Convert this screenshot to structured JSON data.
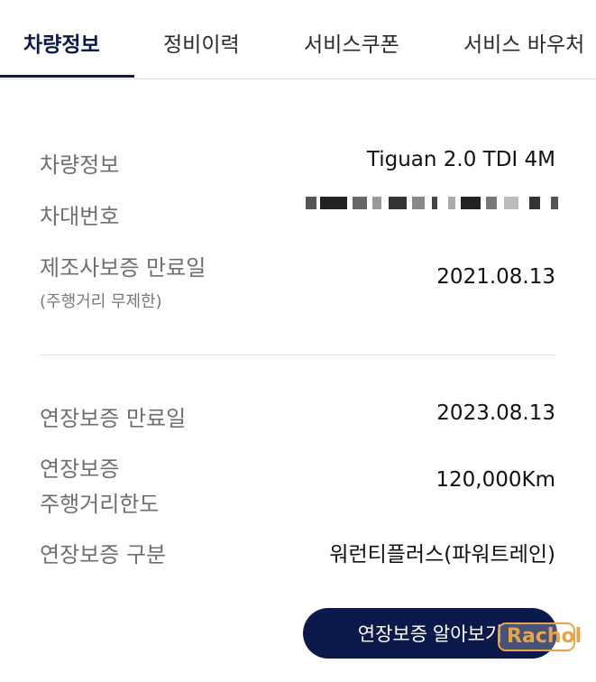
{
  "tabs": [
    {
      "label": "차량정보",
      "active": true
    },
    {
      "label": "정비이력"
    },
    {
      "label": "서비스쿠폰"
    },
    {
      "label": "서비스 바우처"
    }
  ],
  "vehicle": {
    "model_label": "차량정보",
    "model_value": "Tiguan 2.0 TDI 4M",
    "vin_label": "차대번호",
    "mfr_warranty_label": "제조사보증 만료일",
    "mfr_warranty_sub": "(주행거리 무제한)",
    "mfr_warranty_value": "2021.08.13"
  },
  "extended": {
    "expiry_label": "연장보증 만료일",
    "expiry_value": "2023.08.13",
    "mileage_label_line1": "연장보증",
    "mileage_label_line2": "주행거리한도",
    "mileage_value": "120,000Km",
    "type_label": "연장보증 구분",
    "type_value": "워런티플러스(파워트레인)"
  },
  "button": {
    "label": "연장보증 알아보기"
  },
  "watermark": {
    "text": "Rachol"
  },
  "colors": {
    "accent": "#0b1a4a",
    "label": "#6f6f6f",
    "watermark": "#e6a44a"
  }
}
